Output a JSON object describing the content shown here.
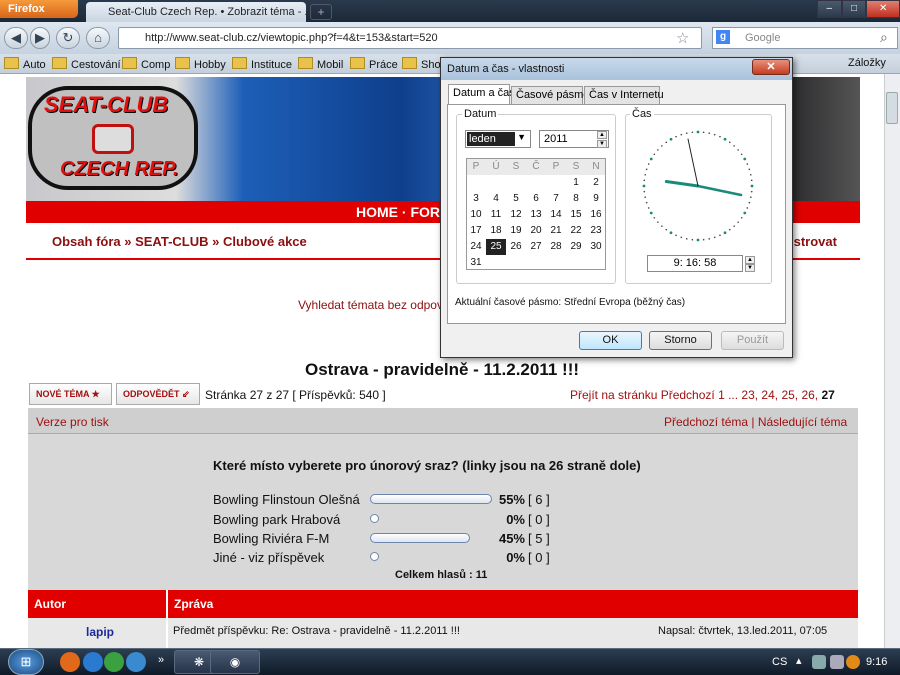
{
  "browser": {
    "menu_button": "Firefox",
    "tab_title": "Seat-Club Czech Rep. • Zobrazit téma - ...",
    "url": "http://www.seat-club.cz/viewtopic.php?f=4&t=153&start=520",
    "search_placeholder": "Google",
    "bookmarks": [
      "Auto",
      "Cestování",
      "Comp",
      "Hobby",
      "Instituce",
      "Mobil",
      "Práce",
      "Shop"
    ],
    "bookmarks_menu": "Záložky"
  },
  "site": {
    "logo_line1": "SEAT-CLUB",
    "logo_line2": "CZECH REP.",
    "menu_text": "HOME · FORUM",
    "breadcrumb": "Obsah fóra » SEAT-CLUB » Clubové akce",
    "register": "istrovat",
    "search_link": "Vyhledat témata bez odpovědí",
    "topic_title": "Ostrava - pravidelně - 11.2.2011 !!!",
    "new_topic_btn": "NOVÉ TÉMA ★",
    "reply_btn": "ODPOVĚDĚT ⇙",
    "page_info": "Stránka 27 z 27 [ Příspěvků: 540 ]",
    "page_nav": "Přejít na stránku Předchozí  1 ... 23, 24, 25, 26, ",
    "page_current": "27",
    "print_link": "Verze pro tisk",
    "nav_links": "Předchozí téma | Následující téma"
  },
  "poll": {
    "question": "Které místo vyberete pro únorový sraz? (linky jsou na 26 straně dole)",
    "options": [
      {
        "label": "Bowling Flinstoun Olešná",
        "percent": 55,
        "pct_text": "55%",
        "count_text": "[ 6 ]"
      },
      {
        "label": "Bowling park Hrabová",
        "percent": 0,
        "pct_text": "0%",
        "count_text": "[ 0 ]"
      },
      {
        "label": "Bowling Riviéra F-M",
        "percent": 45,
        "pct_text": "45%",
        "count_text": "[ 5 ]"
      },
      {
        "label": "Jiné - viz příspěvek",
        "percent": 0,
        "pct_text": "0%",
        "count_text": "[ 0 ]"
      }
    ],
    "total": "Celkem hlasů : 11"
  },
  "post": {
    "col_author": "Autor",
    "col_message": "Zpráva",
    "author": "lapip",
    "subject": "Předmět příspěvku: Re: Ostrava - pravidelně - 11.2.2011 !!!",
    "posted": "Napsal: čtvrtek, 13.led.2011, 07:05"
  },
  "dialog": {
    "title": "Datum a čas - vlastnosti",
    "close": "✕",
    "tabs": [
      "Datum a čas",
      "Časové pásmo",
      "Čas v Internetu"
    ],
    "date_group": "Datum",
    "time_group": "Čas",
    "month": "leden",
    "year": "2011",
    "weekdays": [
      "P",
      "Ú",
      "S",
      "Č",
      "P",
      "S",
      "N"
    ],
    "weeks": [
      [
        "",
        "",
        "",
        "",
        "",
        "1",
        "2"
      ],
      [
        "3",
        "4",
        "5",
        "6",
        "7",
        "8",
        "9"
      ],
      [
        "10",
        "11",
        "12",
        "13",
        "14",
        "15",
        "16"
      ],
      [
        "17",
        "18",
        "19",
        "20",
        "21",
        "22",
        "23"
      ],
      [
        "24",
        "25",
        "26",
        "27",
        "28",
        "29",
        "30"
      ],
      [
        "31",
        "",
        "",
        "",
        "",
        "",
        ""
      ]
    ],
    "selected_day": "25",
    "time": "9: 16: 58",
    "timezone": "Aktuální časové pásmo:  Střední Evropa (běžný čas)",
    "ok": "OK",
    "cancel": "Storno",
    "apply": "Použít"
  },
  "taskbar": {
    "language": "CS",
    "clock": "9:16"
  }
}
